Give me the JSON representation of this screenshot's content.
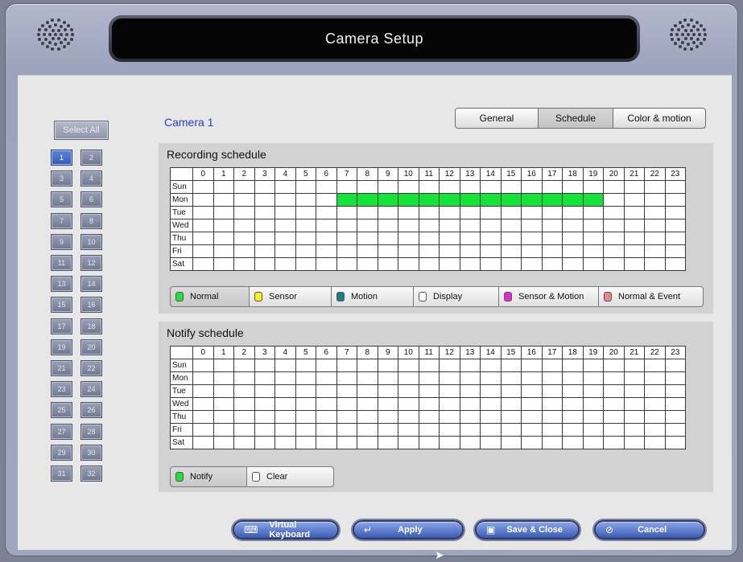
{
  "window": {
    "title": "Camera Setup"
  },
  "sidebar": {
    "select_all": "Select All",
    "cameras": [
      "1",
      "2",
      "3",
      "4",
      "5",
      "6",
      "7",
      "8",
      "9",
      "10",
      "11",
      "12",
      "13",
      "14",
      "15",
      "16",
      "17",
      "18",
      "19",
      "20",
      "21",
      "22",
      "23",
      "24",
      "25",
      "26",
      "27",
      "28",
      "29",
      "30",
      "31",
      "32"
    ],
    "selected": "1"
  },
  "camera_label": "Camera 1",
  "tabs": [
    {
      "label": "General",
      "active": false
    },
    {
      "label": "Schedule",
      "active": true
    },
    {
      "label": "Color & motion",
      "active": false
    }
  ],
  "recording": {
    "title": "Recording schedule",
    "hours": [
      "0",
      "1",
      "2",
      "3",
      "4",
      "5",
      "6",
      "7",
      "8",
      "9",
      "10",
      "11",
      "12",
      "13",
      "14",
      "15",
      "16",
      "17",
      "18",
      "19",
      "20",
      "21",
      "22",
      "23"
    ],
    "days": [
      "Sun",
      "Mon",
      "Tue",
      "Wed",
      "Thu",
      "Fri",
      "Sat"
    ],
    "active_cells": [
      {
        "day": "Mon",
        "from_hour": 7,
        "to_hour": 19,
        "mode": "Normal"
      }
    ],
    "legend": [
      {
        "label": "Normal",
        "color": "#1ee33a",
        "active": true
      },
      {
        "label": "Sensor",
        "color": "#f5f51a",
        "active": false
      },
      {
        "label": "Motion",
        "color": "#1a7f86",
        "active": false
      },
      {
        "label": "Display",
        "color": "#ffffff",
        "active": false
      },
      {
        "label": "Sensor & Motion",
        "color": "#e02ad6",
        "active": false
      },
      {
        "label": "Normal & Event",
        "color": "#ee8585",
        "active": false
      }
    ]
  },
  "notify": {
    "title": "Notify schedule",
    "hours": [
      "0",
      "1",
      "2",
      "3",
      "4",
      "5",
      "6",
      "7",
      "8",
      "9",
      "10",
      "11",
      "12",
      "13",
      "14",
      "15",
      "16",
      "17",
      "18",
      "19",
      "20",
      "21",
      "22",
      "23"
    ],
    "days": [
      "Sun",
      "Mon",
      "Tue",
      "Wed",
      "Thu",
      "Fri",
      "Sat"
    ],
    "legend": [
      {
        "label": "Notify",
        "color": "#1ee33a",
        "active": true
      },
      {
        "label": "Clear",
        "color": "#ffffff",
        "active": false
      }
    ]
  },
  "buttons": {
    "virtual_keyboard": "Virtual Keyboard",
    "apply": "Apply",
    "save_close": "Save & Close",
    "cancel": "Cancel"
  },
  "icons": {
    "keyboard": "keyboard-icon",
    "apply": "enter-icon",
    "save": "save-icon",
    "cancel": "cancel-icon"
  },
  "colors": {
    "accent": "#3a5bb3",
    "schedule_on": "#16e33a",
    "camera_label": "#2a3ad8"
  }
}
